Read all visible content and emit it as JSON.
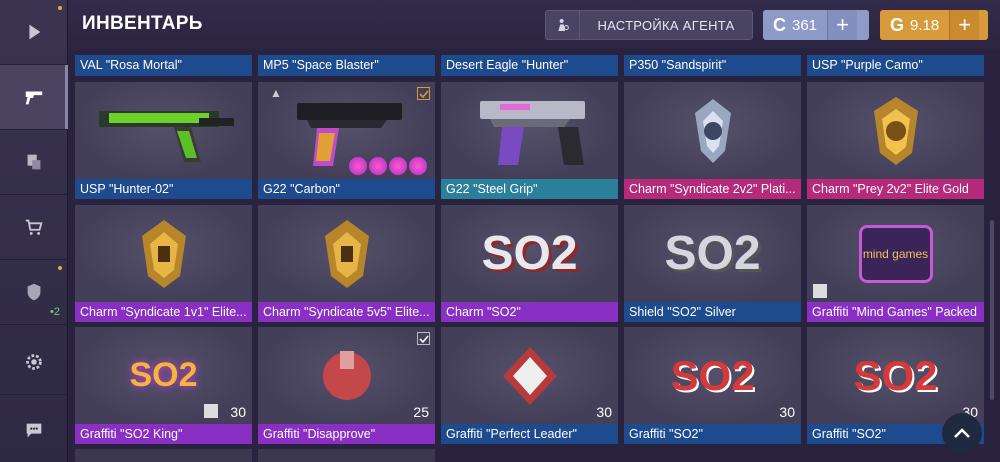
{
  "header": {
    "title": "ИНВЕНТАРЬ",
    "agent_button": "НАСТРОЙКА АГЕНТА",
    "credits": "361",
    "gold": "9.18",
    "credits_symbol": "C",
    "gold_symbol": "G",
    "plus": "+"
  },
  "sidebar": {
    "badge": "2"
  },
  "top_row": [
    "VAL \"Rosa Mortal\"",
    "MP5 \"Space Blaster\"",
    "Desert Eagle \"Hunter\"",
    "P350 \"Sandspirit\"",
    "USP \"Purple Camo\""
  ],
  "rows": [
    [
      {
        "label": "USP \"Hunter-02\"",
        "rarity": "blue"
      },
      {
        "label": "G22 \"Carbon\"",
        "rarity": "blue"
      },
      {
        "label": "G22 \"Steel Grip\"",
        "rarity": "teal"
      },
      {
        "label": "Charm \"Syndicate 2v2\" Plati...",
        "rarity": "pink"
      },
      {
        "label": "Charm \"Prey 2v2\" Elite Gold",
        "rarity": "pink"
      }
    ],
    [
      {
        "label": "Charm \"Syndicate 1v1\" Elite...",
        "rarity": "purple"
      },
      {
        "label": "Charm \"Syndicate 5v5\" Elite...",
        "rarity": "purple"
      },
      {
        "label": "Charm \"SO2\"",
        "rarity": "purple"
      },
      {
        "label": "Shield \"SO2\" Silver",
        "rarity": "blue"
      },
      {
        "label": "Graffiti \"Mind Games\" Packed",
        "rarity": "purple"
      }
    ],
    [
      {
        "label": "Graffiti \"SO2 King\"",
        "rarity": "purple",
        "count": "30"
      },
      {
        "label": "Graffiti \"Disapprove\"",
        "rarity": "purple",
        "count": "25"
      },
      {
        "label": "Graffiti \"Perfect Leader\"",
        "rarity": "blue",
        "count": "30"
      },
      {
        "label": "Graffiti \"SO2\"",
        "rarity": "blue",
        "count": "30"
      },
      {
        "label": "Graffiti \"SO2\"",
        "rarity": "blue",
        "count": "30"
      }
    ]
  ],
  "art_text": {
    "so2": "SO2",
    "mind_games": "mind games"
  }
}
